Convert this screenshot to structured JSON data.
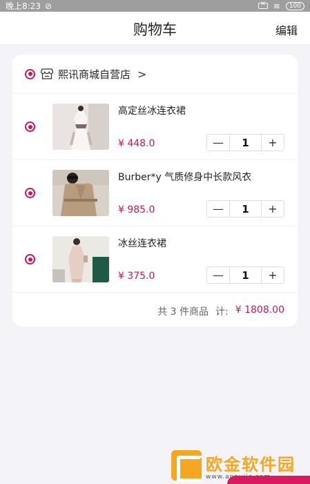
{
  "status": {
    "time": "晚上8:23",
    "battery": "100"
  },
  "nav": {
    "title": "购物车",
    "edit": "编辑"
  },
  "shop": {
    "name": "熙讯商城自营店",
    "chevron": ">"
  },
  "items": [
    {
      "title": "高定丝冰连衣裙",
      "price": "¥ 448.0",
      "qty": "1"
    },
    {
      "title": "Burber*y 气质修身中长款风衣",
      "price": "¥ 985.0",
      "qty": "1"
    },
    {
      "title": "冰丝连衣裙",
      "price": "¥ 375.0",
      "qty": "1"
    }
  ],
  "stepper": {
    "minus": "—",
    "plus": "+"
  },
  "summary": {
    "count_text": "共 3 件商品",
    "total_label": "计:",
    "total_value": "¥ 1808.00"
  },
  "watermark": {
    "cn": "欧金软件园",
    "en": "www.appuijo.com"
  },
  "colors": {
    "accent": "#c2185b",
    "background": "#f4f4f8",
    "watermark": "#f5a623"
  }
}
